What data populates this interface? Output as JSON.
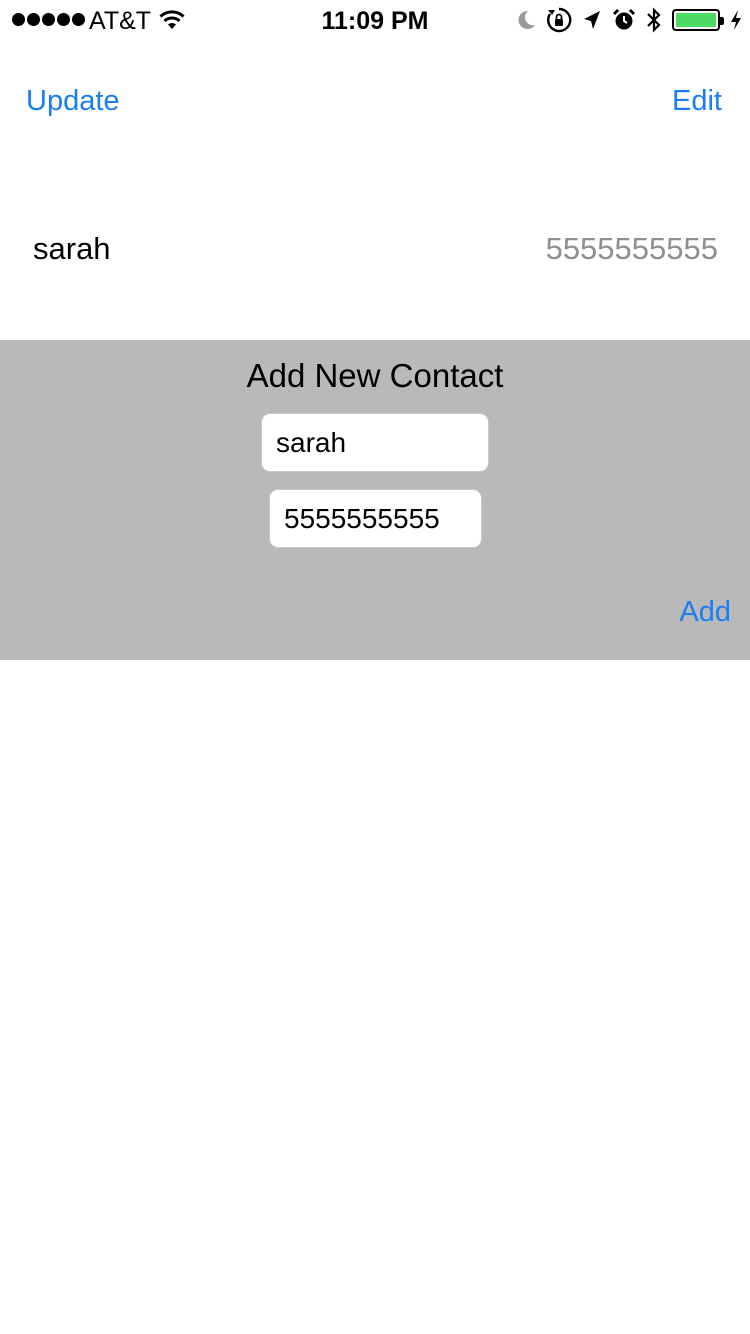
{
  "status_bar": {
    "carrier": "AT&T",
    "time": "11:09 PM",
    "battery_level": 1.0,
    "battery_color": "#4cd964"
  },
  "nav": {
    "left_label": "Update",
    "right_label": "Edit"
  },
  "contacts": [
    {
      "name": "sarah",
      "phone": "5555555555"
    }
  ],
  "add_panel": {
    "title": "Add New Contact",
    "name_value": "sarah",
    "phone_value": "5555555555",
    "add_label": "Add"
  },
  "colors": {
    "accent": "#1b7ef0",
    "panel_bg": "#b9b9b9",
    "secondary_text": "#8e8e93"
  }
}
